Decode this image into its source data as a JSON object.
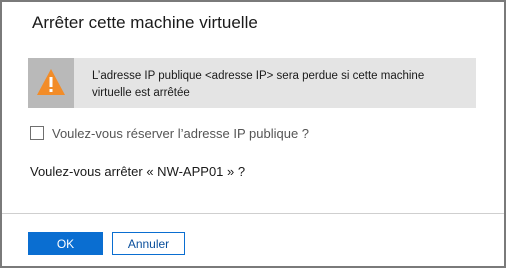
{
  "dialog": {
    "title": "Arrêter cette machine virtuelle",
    "warning": {
      "icon": "warning-triangle-icon",
      "icon_color": "#f28c28",
      "text": "L’adresse IP publique <adresse IP> sera perdue si cette machine virtuelle est arrêtée"
    },
    "reserve_ip": {
      "label": "Voulez-vous réserver l’adresse IP publique ?",
      "checked": false
    },
    "question": "Voulez-vous arrêter « NW-APP01 » ?",
    "buttons": {
      "ok_label": "OK",
      "cancel_label": "Annuler"
    },
    "colors": {
      "primary": "#0a6ed1",
      "banner_bg": "#e4e4e4"
    }
  }
}
